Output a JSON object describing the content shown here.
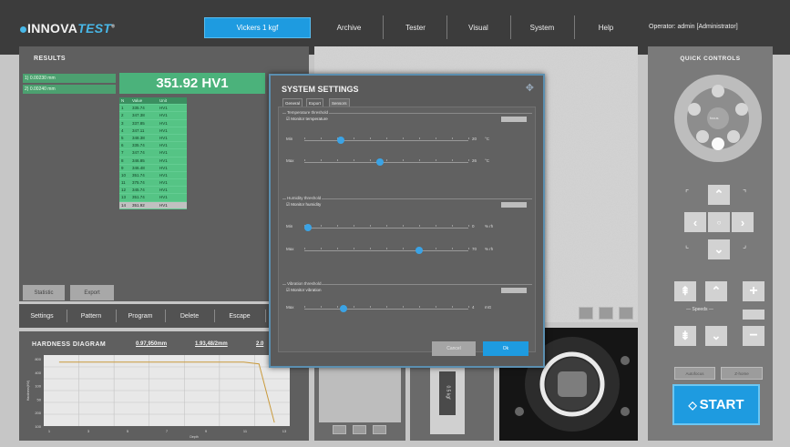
{
  "brand": {
    "part1": "INNOVA",
    "part2": "TEST",
    "reg": "®"
  },
  "nav": {
    "load_button": "Vickers 1 kgf",
    "items": [
      "Archive",
      "Tester",
      "Visual",
      "System",
      "Help"
    ]
  },
  "operator": "Operator: admin   [Administrator]",
  "results": {
    "title": "RESULTS",
    "items": [
      "1) 0.00230 mm",
      "2) 0.00240 mm"
    ],
    "main_value": "351.92 HV1",
    "columns": [
      "N",
      "Value",
      "Unit"
    ],
    "rows": [
      [
        "1",
        "335.74",
        "HV1"
      ],
      [
        "2",
        "347.38",
        "HV1"
      ],
      [
        "3",
        "337.85",
        "HV1"
      ],
      [
        "4",
        "347.11",
        "HV1"
      ],
      [
        "5",
        "348.38",
        "HV1"
      ],
      [
        "6",
        "335.74",
        "HV1"
      ],
      [
        "7",
        "347.74",
        "HV1"
      ],
      [
        "8",
        "346.85",
        "HV1"
      ],
      [
        "9",
        "346.48",
        "HV1"
      ],
      [
        "10",
        "351.74",
        "HV1"
      ],
      [
        "11",
        "375.74",
        "HV1"
      ],
      [
        "12",
        "345.74",
        "HV1"
      ],
      [
        "13",
        "351.74",
        "HV1"
      ],
      [
        "14",
        "351.92",
        "HV1"
      ]
    ],
    "buttons": [
      "Statistic",
      "Export"
    ]
  },
  "toolbar": [
    "Settings",
    "Pattern",
    "Program",
    "Delete",
    "Escape"
  ],
  "hardness": {
    "title": "HARDNESS DIAGRAM",
    "links": [
      "0.97,950mm",
      "1.93,48/2mm",
      "2.0"
    ],
    "ylabel": "Hardness(HV)",
    "xlabel": "Depth"
  },
  "chart_data": {
    "type": "line",
    "title": "HARDNESS DIAGRAM",
    "xlabel": "Depth",
    "ylabel": "Hardness(HV)",
    "x": [
      1,
      3,
      5,
      7,
      9,
      11,
      13,
      14,
      15
    ],
    "series": [
      {
        "values": [
          720,
          720,
          720,
          720,
          720,
          720,
          720,
          700,
          40
        ]
      }
    ],
    "xlim": [
      0,
      16
    ],
    "ylim": [
      0,
      800
    ],
    "yticks": [
      800,
      400,
      100,
      50,
      200,
      100
    ],
    "xticks": [
      "1",
      "3",
      "5",
      "7",
      "9",
      "11",
      "13"
    ],
    "line_color": "#c99a3c",
    "grid": true
  },
  "dialog": {
    "title": "SYSTEM SETTINGS",
    "tabs": [
      "General",
      "Export",
      "Sensors"
    ],
    "groups": [
      {
        "title": "Temperature threshold",
        "check": "Monitor temperature",
        "sliders": [
          {
            "label": "Min",
            "value": "20",
            "unit": "°C",
            "pos": 0.22
          },
          {
            "label": "Max",
            "value": "26",
            "unit": "°C",
            "pos": 0.46
          }
        ]
      },
      {
        "title": "Humidity threshold",
        "check": "Monitor humidity",
        "sliders": [
          {
            "label": "Min",
            "value": "0",
            "unit": "% rh",
            "pos": 0.02
          },
          {
            "label": "Max",
            "value": "70",
            "unit": "% rh",
            "pos": 0.7
          }
        ]
      },
      {
        "title": "Vibration threshold",
        "check": "Monitor vibration",
        "sliders": [
          {
            "label": "Max",
            "value": "4",
            "unit": "mG",
            "pos": 0.24
          }
        ]
      }
    ],
    "cancel": "Cancel",
    "ok": "Ok"
  },
  "turret": {
    "label": "0.5 kgf"
  },
  "quick": {
    "title": "QUICK CONTROLS",
    "center_label": "focus",
    "speed_label": "Speeds",
    "small_buttons": [
      "Autofocus",
      "Z-home"
    ],
    "start": "START",
    "start_glyph": "◇"
  },
  "colors": {
    "accent": "#1e9be0",
    "result_green": "#4bb27b",
    "panel": "#5f5f5f",
    "topbar": "#3c3c3c"
  }
}
